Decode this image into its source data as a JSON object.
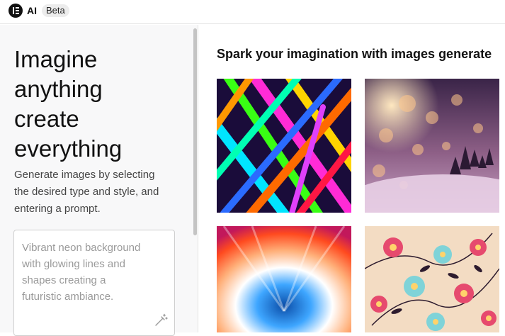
{
  "header": {
    "app_title": "AI",
    "badge": "Beta",
    "logo_icon": "elementor-logo-icon"
  },
  "sidebar": {
    "headline_lines": [
      "Imagine",
      "anything",
      "create",
      "everything"
    ],
    "description_lines": [
      "Generate images by selecting",
      "the desired type and style, and",
      "entering a prompt."
    ],
    "prompt": {
      "placeholder_lines": [
        "Vibrant neon background",
        "with glowing lines and",
        "shapes creating a",
        "futuristic ambiance."
      ],
      "action_icon": "magic-wand-icon"
    }
  },
  "main": {
    "title": "Spark your imagination with images generate",
    "gallery": [
      {
        "id": "neon-lines"
      },
      {
        "id": "winter-bokeh"
      },
      {
        "id": "light-tunnel"
      },
      {
        "id": "floral-pattern"
      }
    ]
  },
  "colors": {
    "accent": "#111111",
    "panel_bg": "#f8f8f9",
    "placeholder": "#9a9a9a"
  }
}
